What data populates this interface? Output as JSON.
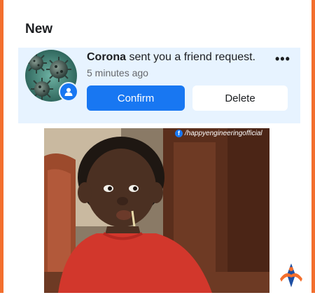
{
  "section": {
    "title": "New"
  },
  "notification": {
    "sender": "Corona",
    "message": " sent you a friend request.",
    "time": "5 minutes ago",
    "more_icon": "more-horizontal-icon",
    "avatar_badge_icon": "friend-request-person-icon",
    "confirm_label": "Confirm",
    "delete_label": "Delete"
  },
  "meme": {
    "watermark": "/happyengineeringofficial",
    "watermark_icon": "facebook-icon"
  },
  "logo": {
    "icon": "brand-logo-icon"
  },
  "colors": {
    "accent": "#1877f2",
    "highlight": "#e7f3ff",
    "frame": "#f36f2e",
    "text": "#1c1e21",
    "muted": "#65676b"
  }
}
